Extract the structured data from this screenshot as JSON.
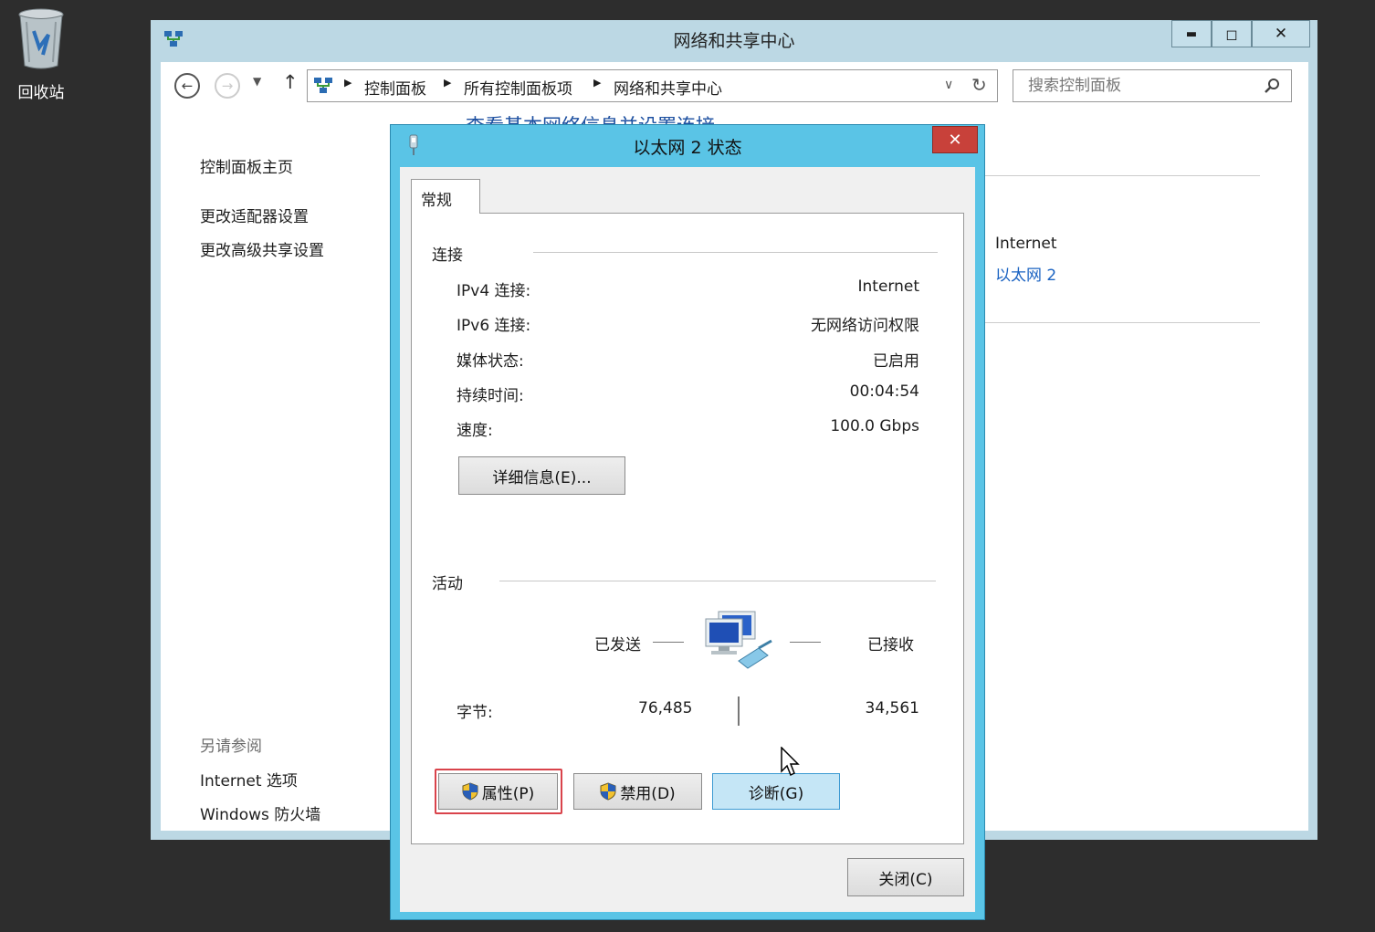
{
  "desktop": {
    "recycle_label": "回收站"
  },
  "main_window": {
    "title": "网络和共享中心",
    "controls": {
      "minimize": "▬",
      "maximize": "◻",
      "close": "✕"
    },
    "breadcrumbs": [
      "控制面板",
      "所有控制面板项",
      "网络和共享中心"
    ],
    "search_placeholder": "搜索控制面板",
    "heading_partial": "查看基本网络信息并设置连接",
    "sidebar": {
      "items": [
        "控制面板主页",
        "更改适配器设置",
        "更改高级共享设置"
      ],
      "see_also_label": "另请参阅",
      "see_also": [
        "Internet 选项",
        "Windows 防火墙"
      ]
    },
    "network": {
      "access_type": "Internet",
      "connection_link": "以太网 2"
    }
  },
  "dialog": {
    "title": "以太网 2 状态",
    "close": "✕",
    "tab": "常规",
    "connection": {
      "group_label": "连接",
      "rows": [
        {
          "label": "IPv4 连接:",
          "value": "Internet"
        },
        {
          "label": "IPv6 连接:",
          "value": "无网络访问权限"
        },
        {
          "label": "媒体状态:",
          "value": "已启用"
        },
        {
          "label": "持续时间:",
          "value": "00:04:54"
        },
        {
          "label": "速度:",
          "value": "100.0 Gbps"
        }
      ],
      "details_button": "详细信息(E)..."
    },
    "activity": {
      "group_label": "活动",
      "sent_label": "已发送",
      "received_label": "已接收",
      "bytes_label": "字节:",
      "bytes_sent": "76,485",
      "bytes_received": "34,561"
    },
    "buttons": {
      "properties": "属性(P)",
      "disable": "禁用(D)",
      "diagnose": "诊断(G)",
      "close": "关闭(C)"
    }
  }
}
